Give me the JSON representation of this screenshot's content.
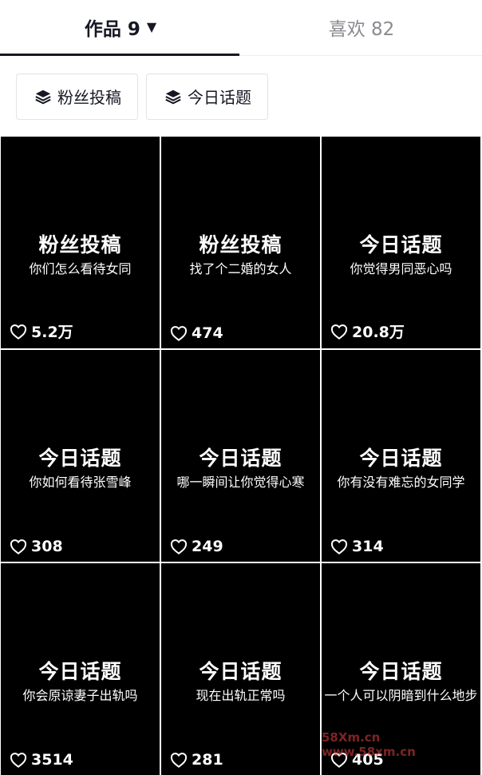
{
  "tabs": [
    {
      "label": "作品 9",
      "active": true
    },
    {
      "label": "喜欢 82",
      "active": false
    }
  ],
  "chips": [
    {
      "label": "粉丝投稿"
    },
    {
      "label": "今日话题"
    }
  ],
  "videos": [
    {
      "title": "粉丝投稿",
      "subtitle": "你们怎么看待女同",
      "likes": "5.2万"
    },
    {
      "title": "粉丝投稿",
      "subtitle": "找了个二婚的女人",
      "likes": "474"
    },
    {
      "title": "今日话题",
      "subtitle": "你觉得男同恶心吗",
      "likes": "20.8万"
    },
    {
      "title": "今日话题",
      "subtitle": "你如何看待张雪峰",
      "likes": "308"
    },
    {
      "title": "今日话题",
      "subtitle": "哪一瞬间让你觉得心寒",
      "likes": "249"
    },
    {
      "title": "今日话题",
      "subtitle": "你有没有难忘的女同学",
      "likes": "314"
    },
    {
      "title": "今日话题",
      "subtitle": "你会原谅妻子出轨吗",
      "likes": "3514"
    },
    {
      "title": "今日话题",
      "subtitle": "现在出轨正常吗",
      "likes": "281"
    },
    {
      "title": "今日话题",
      "subtitle": "一个人可以阴暗到什么地步",
      "likes": "405"
    }
  ],
  "watermark": "58Xm.cn www.58xm.cn",
  "colors": {
    "text": "#161823",
    "inactive": "#8a8b91",
    "tile_bg": "#000000"
  }
}
